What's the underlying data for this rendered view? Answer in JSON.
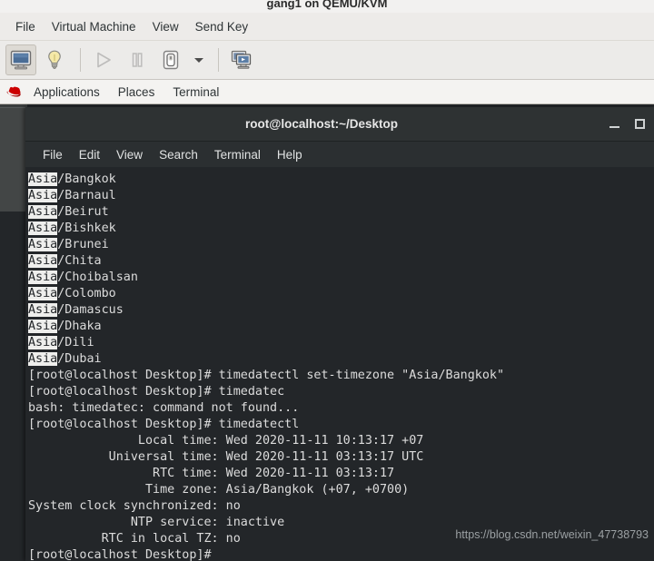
{
  "vm_window": {
    "title": "gang1 on QEMU/KVM",
    "menus": [
      {
        "label": "File",
        "name": "vm-menu-file"
      },
      {
        "label": "Virtual Machine",
        "name": "vm-menu-virtual-machine"
      },
      {
        "label": "View",
        "name": "vm-menu-view"
      },
      {
        "label": "Send Key",
        "name": "vm-menu-send-key"
      }
    ],
    "toolbar": [
      {
        "icon": "monitor-console-icon",
        "name": "show-console-button",
        "state": "active"
      },
      {
        "icon": "lightbulb-details-icon",
        "name": "show-details-button",
        "state": "normal"
      },
      {
        "icon": "play-icon",
        "name": "run-vm-button",
        "state": "disabled"
      },
      {
        "icon": "pause-icon",
        "name": "pause-vm-button",
        "state": "disabled"
      },
      {
        "icon": "power-shutdown-icon",
        "name": "shutdown-vm-button",
        "state": "normal"
      },
      {
        "icon": "chevron-down-icon",
        "name": "shutdown-options-dropdown",
        "state": "normal"
      },
      {
        "icon": "multi-screen-icon",
        "name": "toggle-fullscreen-button",
        "state": "normal"
      }
    ]
  },
  "gnome_panel": {
    "logo": "red-hat-logo",
    "items": [
      {
        "label": "Applications",
        "name": "panel-applications-menu"
      },
      {
        "label": "Places",
        "name": "panel-places-menu"
      },
      {
        "label": "Terminal",
        "name": "panel-terminal-window-item"
      }
    ]
  },
  "terminal": {
    "title": "root@localhost:~/Desktop",
    "window_buttons": [
      {
        "icon": "minimize-icon",
        "name": "terminal-minimize-button"
      },
      {
        "icon": "maximize-icon",
        "name": "terminal-maximize-button"
      }
    ],
    "menus": [
      {
        "label": "File",
        "name": "terminal-menu-file"
      },
      {
        "label": "Edit",
        "name": "terminal-menu-edit"
      },
      {
        "label": "View",
        "name": "terminal-menu-view"
      },
      {
        "label": "Search",
        "name": "terminal-menu-search"
      },
      {
        "label": "Terminal",
        "name": "terminal-menu-terminal"
      },
      {
        "label": "Help",
        "name": "terminal-menu-help"
      }
    ],
    "lines": [
      {
        "segments": [
          {
            "text": "Asia",
            "highlight": true
          },
          {
            "text": "/Bangkok",
            "highlight": false
          }
        ]
      },
      {
        "segments": [
          {
            "text": "Asia",
            "highlight": true
          },
          {
            "text": "/Barnaul",
            "highlight": false
          }
        ]
      },
      {
        "segments": [
          {
            "text": "Asia",
            "highlight": true
          },
          {
            "text": "/Beirut",
            "highlight": false
          }
        ]
      },
      {
        "segments": [
          {
            "text": "Asia",
            "highlight": true
          },
          {
            "text": "/Bishkek",
            "highlight": false
          }
        ]
      },
      {
        "segments": [
          {
            "text": "Asia",
            "highlight": true
          },
          {
            "text": "/Brunei",
            "highlight": false
          }
        ]
      },
      {
        "segments": [
          {
            "text": "Asia",
            "highlight": true
          },
          {
            "text": "/Chita",
            "highlight": false
          }
        ]
      },
      {
        "segments": [
          {
            "text": "Asia",
            "highlight": true
          },
          {
            "text": "/Choibalsan",
            "highlight": false
          }
        ]
      },
      {
        "segments": [
          {
            "text": "Asia",
            "highlight": true
          },
          {
            "text": "/Colombo",
            "highlight": false
          }
        ]
      },
      {
        "segments": [
          {
            "text": "Asia",
            "highlight": true
          },
          {
            "text": "/Damascus",
            "highlight": false
          }
        ]
      },
      {
        "segments": [
          {
            "text": "Asia",
            "highlight": true
          },
          {
            "text": "/Dhaka",
            "highlight": false
          }
        ]
      },
      {
        "segments": [
          {
            "text": "Asia",
            "highlight": true
          },
          {
            "text": "/Dili",
            "highlight": false
          }
        ]
      },
      {
        "segments": [
          {
            "text": "Asia",
            "highlight": true
          },
          {
            "text": "/Dubai",
            "highlight": false
          }
        ]
      },
      {
        "segments": [
          {
            "text": "[root@localhost Desktop]# timedatectl set-timezone \"Asia/Bangkok\"",
            "highlight": false
          }
        ]
      },
      {
        "segments": [
          {
            "text": "[root@localhost Desktop]# timedatec",
            "highlight": false
          }
        ]
      },
      {
        "segments": [
          {
            "text": "bash: timedatec: command not found...",
            "highlight": false
          }
        ]
      },
      {
        "segments": [
          {
            "text": "[root@localhost Desktop]# timedatectl",
            "highlight": false
          }
        ]
      },
      {
        "segments": [
          {
            "text": "               Local time: Wed 2020-11-11 10:13:17 +07",
            "highlight": false
          }
        ]
      },
      {
        "segments": [
          {
            "text": "           Universal time: Wed 2020-11-11 03:13:17 UTC",
            "highlight": false
          }
        ]
      },
      {
        "segments": [
          {
            "text": "                 RTC time: Wed 2020-11-11 03:13:17",
            "highlight": false
          }
        ]
      },
      {
        "segments": [
          {
            "text": "                Time zone: Asia/Bangkok (+07, +0700)",
            "highlight": false
          }
        ]
      },
      {
        "segments": [
          {
            "text": "System clock synchronized: no",
            "highlight": false
          }
        ]
      },
      {
        "segments": [
          {
            "text": "              NTP service: inactive",
            "highlight": false
          }
        ]
      },
      {
        "segments": [
          {
            "text": "          RTC in local TZ: no",
            "highlight": false
          }
        ]
      },
      {
        "segments": [
          {
            "text": "[root@localhost Desktop]# ",
            "highlight": false
          }
        ]
      }
    ]
  },
  "watermark": {
    "text": "https://blog.csdn.net/weixin_47738793"
  },
  "colors": {
    "terminal_bg": "#232629",
    "terminal_fg": "#dcdcdc",
    "highlight_bg": "#eeeeec",
    "highlight_fg": "#232629",
    "chrome_bg": "#edebe9",
    "titlebar_bg": "#2e3233",
    "redhat_red": "#cc0000"
  }
}
